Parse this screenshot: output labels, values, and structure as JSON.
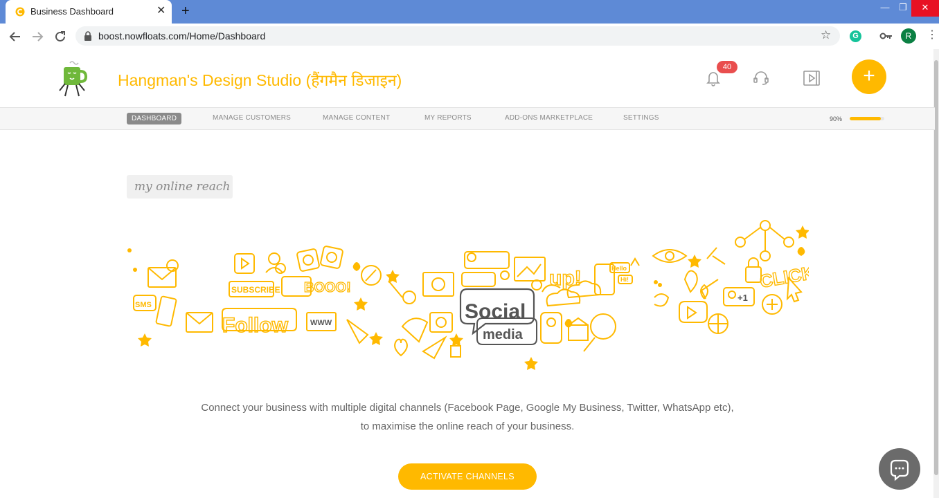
{
  "browser": {
    "tab_title": "Business Dashboard",
    "url": "boost.nowfloats.com/Home/Dashboard",
    "profile_initial": "R",
    "extension_initial": "G"
  },
  "header": {
    "business_name": "Hangman's Design Studio (हैंगमैन डिजाइन)",
    "notification_count": "40",
    "add_label": "+"
  },
  "nav": {
    "items": [
      {
        "label": "DASHBOARD",
        "active": true
      },
      {
        "label": "MANAGE CUSTOMERS"
      },
      {
        "label": "MANAGE CONTENT"
      },
      {
        "label": "MY REPORTS"
      },
      {
        "label": "ADD-ONS MARKETPLACE"
      },
      {
        "label": "SETTINGS"
      }
    ],
    "progress_label": "90%",
    "progress_value": 0.9
  },
  "main": {
    "section_title": "my online reach",
    "banner_words": [
      "SMS",
      "SUBSCRIBE",
      "Follow",
      "BOOO!",
      "WWW",
      "Social",
      "media",
      "up!",
      "Hello",
      "Hi!",
      "CLICK",
      "+1"
    ],
    "description_line1": "Connect your business with multiple digital channels (Facebook Page, Google My Business, Twitter, WhatsApp etc),",
    "description_line2": "to maximise the online reach of your business.",
    "cta_label": "ACTIVATE CHANNELS"
  },
  "colors": {
    "brand": "#ffb900",
    "badge": "#e94e4e",
    "tabbar": "#5e8ad6"
  }
}
